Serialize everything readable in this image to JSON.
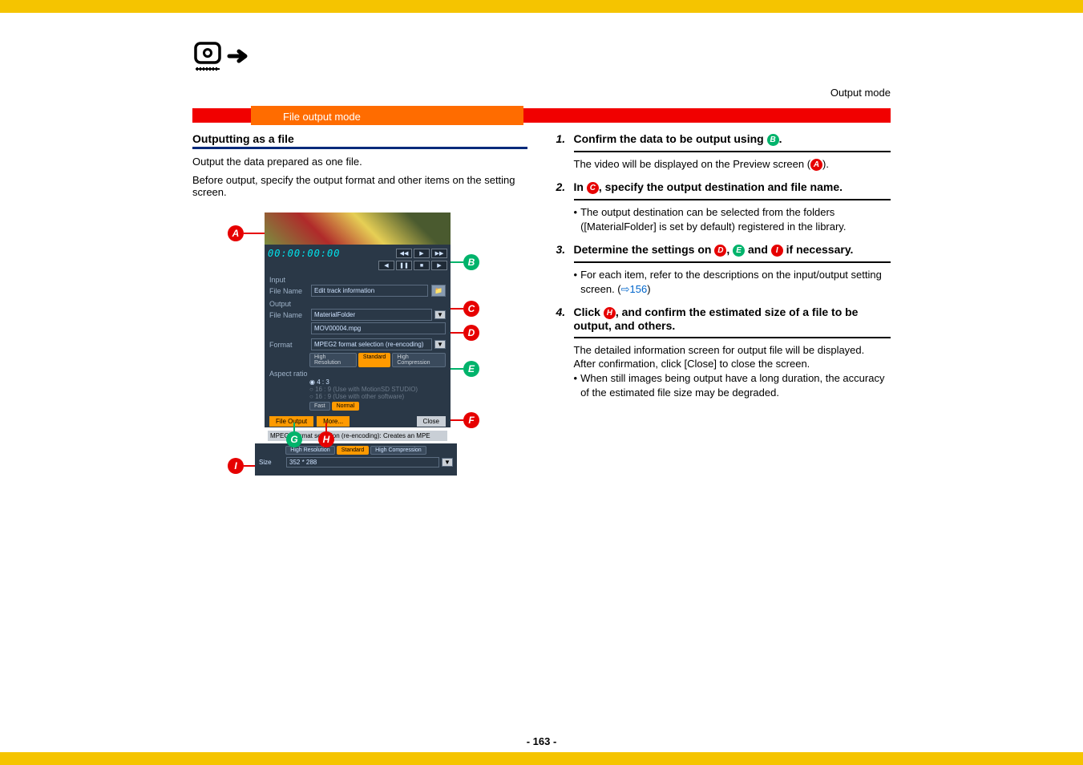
{
  "meta": {
    "top_label": "Output mode",
    "banner_label": "File output mode",
    "page_number": "- 163 -"
  },
  "left": {
    "heading": "Outputting as a file",
    "p1": "Output the data prepared as one file.",
    "p2": "Before output, specify the output format and other items on the setting screen."
  },
  "screenshot": {
    "timecode": "00:00:00:00",
    "btn_rewind": "◀◀",
    "btn_play": "▶",
    "btn_ff": "▶▶",
    "btn_prev": "◀",
    "btn_pause": "❚❚",
    "btn_stop": "■",
    "btn_next": "▶",
    "input_label": "Input",
    "output_label": "Output",
    "filename_label": "File Name",
    "input_filename": "Edit track information",
    "output_folder": "MaterialFolder",
    "output_filename": "MOV00004.mpg",
    "format_label": "Format",
    "format_value": "MPEG2 format selection (re-encoding)",
    "pill_hires": "High Resolution",
    "pill_standard": "Standard",
    "pill_hicomp": "High Compression",
    "aspect_label": "Aspect ratio",
    "aspect_43": "4 : 3",
    "aspect_169a": "16 : 9  (Use with MotionSD STUDIO)",
    "aspect_169b": "16 : 9  (Use with other software)",
    "pill_fast": "Fast",
    "pill_normal": "Normal",
    "btn_fileoutput": "File Output",
    "btn_more": "More...",
    "btn_close": "Close",
    "status": "MPEG2 format selection (re-encoding):  Creates an MPE",
    "size_label": "Size",
    "size_value": "352 * 288"
  },
  "callouts": {
    "A": "A",
    "B": "B",
    "C": "C",
    "D": "D",
    "E": "E",
    "F": "F",
    "G": "G",
    "H": "H",
    "I": "I"
  },
  "steps": {
    "s1": {
      "n": "1.",
      "t_before": "Confirm the data to be output using ",
      "t_after": ".",
      "body_a": "The video will be displayed on the Preview screen (",
      "body_b": ")."
    },
    "s2": {
      "n": "2.",
      "t_before": "In ",
      "t_after": ", specify the output destination and file name.",
      "bullet": "The output destination can be selected from the folders ([MaterialFolder] is set by default) registered in the library."
    },
    "s3": {
      "n": "3.",
      "t_before": "Determine the settings on ",
      "t_mid1": ", ",
      "t_mid2": " and ",
      "t_after": " if necessary.",
      "bullet_a": "For each item, refer to the descriptions on the input/output setting screen. (",
      "link_arrow": "⇨",
      "link_text": "156",
      "bullet_b": ")"
    },
    "s4": {
      "n": "4.",
      "t_before": "Click ",
      "t_after": ", and confirm the estimated size of a file to be output, and others.",
      "body1": "The detailed information screen for output file will be displayed.",
      "body2": "After confirmation, click [Close] to close the screen.",
      "bullet": "When still images being output have a long duration, the accuracy of the estimated file size may be degraded."
    }
  }
}
